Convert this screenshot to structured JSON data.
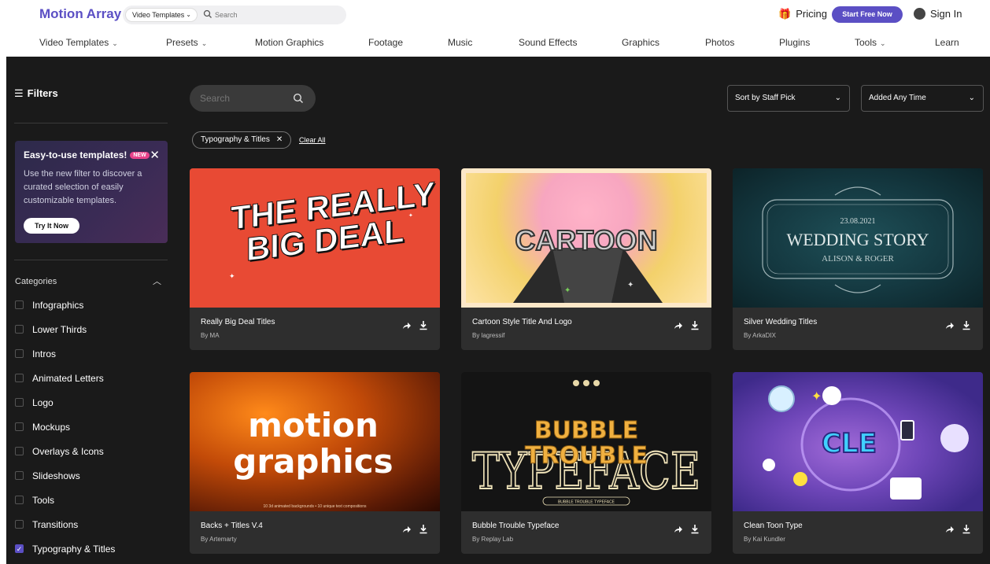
{
  "header": {
    "logo": "Motion Array",
    "search_type": "Video Templates",
    "search_placeholder": "Search",
    "pricing": "Pricing",
    "start_free": "Start Free Now",
    "sign_in": "Sign In"
  },
  "nav": [
    {
      "label": "Video Templates",
      "has_dropdown": true
    },
    {
      "label": "Presets",
      "has_dropdown": true
    },
    {
      "label": "Motion Graphics",
      "has_dropdown": false
    },
    {
      "label": "Footage",
      "has_dropdown": false
    },
    {
      "label": "Music",
      "has_dropdown": false
    },
    {
      "label": "Sound Effects",
      "has_dropdown": false
    },
    {
      "label": "Graphics",
      "has_dropdown": false
    },
    {
      "label": "Photos",
      "has_dropdown": false
    },
    {
      "label": "Plugins",
      "has_dropdown": false
    },
    {
      "label": "Tools",
      "has_dropdown": true
    },
    {
      "label": "Learn",
      "has_dropdown": false
    }
  ],
  "sidebar": {
    "filters_label": "Filters",
    "promo": {
      "title": "Easy-to-use templates!",
      "badge": "NEW",
      "text": "Use the new filter to discover a curated selection of easily customizable templates.",
      "button": "Try It Now"
    },
    "categories_label": "Categories",
    "categories": [
      {
        "label": "Infographics",
        "checked": false
      },
      {
        "label": "Lower Thirds",
        "checked": false
      },
      {
        "label": "Intros",
        "checked": false
      },
      {
        "label": "Animated Letters",
        "checked": false
      },
      {
        "label": "Logo",
        "checked": false
      },
      {
        "label": "Mockups",
        "checked": false
      },
      {
        "label": "Overlays & Icons",
        "checked": false
      },
      {
        "label": "Slideshows",
        "checked": false
      },
      {
        "label": "Tools",
        "checked": false
      },
      {
        "label": "Transitions",
        "checked": false
      },
      {
        "label": "Typography & Titles",
        "checked": true
      }
    ]
  },
  "main": {
    "search_placeholder": "Search",
    "sort": "Sort by Staff Pick",
    "time_filter": "Added Any Time",
    "active_filter": "Typography & Titles",
    "clear_all": "Clear All",
    "cards": [
      {
        "title": "Really Big Deal Titles",
        "author": "By MA",
        "thumb_text": [
          "THE REALLY",
          "BIG DEAL"
        ]
      },
      {
        "title": "Cartoon Style Title And Logo",
        "author": "By lagressif",
        "thumb_text": [
          "CARTOON"
        ]
      },
      {
        "title": "Silver Wedding Titles",
        "author": "By ArkaDIX",
        "thumb_text": [
          "23.08.2021",
          "WEDDING STORY",
          "ALISON & ROGER"
        ]
      },
      {
        "title": "Backs + Titles V.4",
        "author": "By Artemarty",
        "thumb_text": [
          "motion",
          "graphics",
          "10 3d animated backgrounds • 10 unique text compositions"
        ]
      },
      {
        "title": "Bubble Trouble Typeface",
        "author": "By Replay Lab",
        "thumb_text": [
          "TYPEFACE",
          "BUBBLE",
          "TROUBLE",
          "BUBBLE TROUBLE TYPEFACE"
        ]
      },
      {
        "title": "Clean Toon Type",
        "author": "By Kai Kundler",
        "thumb_text": [
          "CLE"
        ]
      }
    ]
  }
}
